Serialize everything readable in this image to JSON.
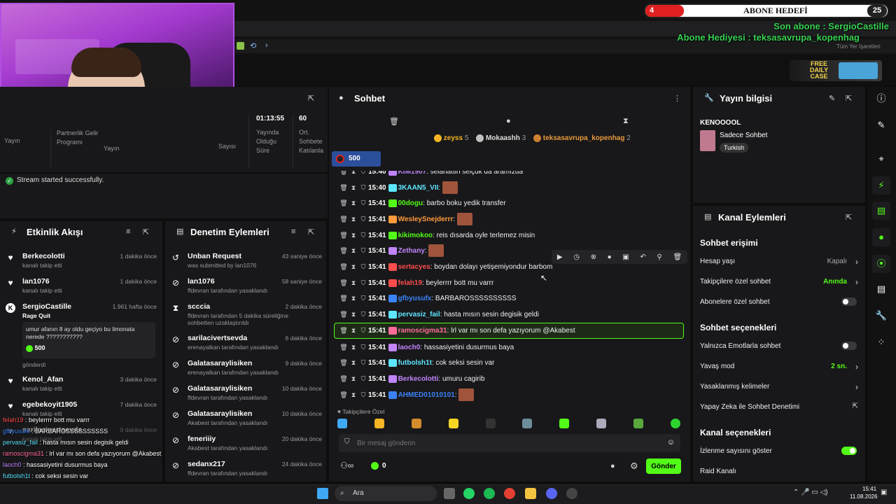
{
  "overlay": {
    "sub_goal": {
      "current": "4",
      "label": "ABONE HEDEFİ",
      "target": "25"
    },
    "alert_sub": "Son abone : SergioCastille",
    "alert_gift": "Abone Hediyesi : teksasavrupa_kopenhag",
    "all_bookmarks": "Tüm Yer İşaretleri",
    "promo": "FREE DAILY CASE"
  },
  "stats": {
    "items": [
      {
        "label": "Partnerlik Gelir Programı"
      },
      {
        "label": "Yayın"
      },
      {
        "value": "01:13:55",
        "label": "Yayında Olduğu Süre"
      },
      {
        "value": "60",
        "label": "Ort. Sohbete Katılanla"
      }
    ],
    "partial_label": "Sayısı",
    "left_label": "Yayın"
  },
  "success_msg": "Stream started successfully.",
  "events": {
    "title": "Etkinlik Akışı",
    "items": [
      {
        "name": "Berkecolotti",
        "sub": "kanalı takip etti",
        "time": "1 dakika önce"
      },
      {
        "name": "lan1076",
        "sub": "kanalı takip etti",
        "time": "1 dakika önce"
      },
      {
        "name": "SergioCastille",
        "sub": "Rage Quit",
        "time": "1.961 hafta önce",
        "message": "umur afanın 8 ay oldu geçiyo bu limonata nerede ???????????",
        "amount": "500",
        "note": "gönderdi"
      },
      {
        "name": "Kenol_Afan",
        "sub": "kanalı takip etti",
        "time": "3 dakika önce"
      },
      {
        "name": "egebekoyit1905",
        "sub": "kanalı takip etti",
        "time": "7 dakika önce"
      },
      {
        "name": "sarilacivertsevda",
        "sub": "kanalı takip etti",
        "time": "9 dakika önce"
      }
    ]
  },
  "moderation": {
    "title": "Denetim Eylemleri",
    "items": [
      {
        "name": "Unban Request",
        "sub": "was submitted by lan1076",
        "time": "43 saniye önce"
      },
      {
        "name": "lan1076",
        "sub": "ffdevran tarafından yasaklandı",
        "time": "58 saniye önce"
      },
      {
        "name": "scccia",
        "sub": "ffdevran tarafından 5 dakika süreliğine sohbetten uzaklaştırıldı",
        "time": "2 dakika önce"
      },
      {
        "name": "sarilacivertsevda",
        "sub": "erenayalkan tarafından yasaklandı",
        "time": "6 dakika önce"
      },
      {
        "name": "Galatasaraylisiken",
        "sub": "erenayalkan tarafından yasaklandı",
        "time": "9 dakika önce"
      },
      {
        "name": "Galatasaraylisiken",
        "sub": "ffdevran tarafından yasaklandı",
        "time": "10 dakika önce"
      },
      {
        "name": "Galatasaraylisiken",
        "sub": "Akabest tarafından yasaklandı",
        "time": "10 dakika önce"
      },
      {
        "name": "feneriiiy",
        "sub": "Akabest tarafından yasaklandı",
        "time": "20 dakika önce"
      },
      {
        "name": "sedanx217",
        "sub": "ffdevran tarafından yasaklandı",
        "time": "24 dakika önce"
      }
    ]
  },
  "chat": {
    "title": "Sohbet",
    "top_gifters": [
      {
        "name": "zeyss",
        "count": "5"
      },
      {
        "name": "Mokaashh",
        "count": "3"
      },
      {
        "name": "teksasavrupa_kopenhag",
        "count": "2"
      }
    ],
    "pinned_amount": "500",
    "messages": [
      {
        "time": "15:40",
        "user": "KIM1907",
        "color": "#c084fc",
        "text": "selahattin selçuk da aramızda"
      },
      {
        "time": "15:40",
        "user": "3KAAN5_VII",
        "color": "#5ee6ff",
        "text": ""
      },
      {
        "time": "15:41",
        "user": "00dogu",
        "color": "#53fc18",
        "text": "barbo boku yedik transfer"
      },
      {
        "time": "15:41",
        "user": "WesleySnejderrr",
        "color": "#ff9a3c",
        "text": ""
      },
      {
        "time": "15:41",
        "user": "kikimokoo",
        "color": "#53fc18",
        "text": "reis dısarda oyle terlemez misin"
      },
      {
        "time": "15:41",
        "user": "Zethany",
        "color": "#c084fc",
        "text": ""
      },
      {
        "time": "15:41",
        "user": "sertacyes",
        "color": "#ff4d4d",
        "text": "boydan dolayı yetişemiyondur barbom"
      },
      {
        "time": "15:41",
        "user": "felah19",
        "color": "#ff4d4d",
        "text": "beylerrrr bott mu varrr"
      },
      {
        "time": "15:41",
        "user": "gfbyusufx",
        "color": "#3b82f6",
        "text": "BARBAROSSSSSSSSSS"
      },
      {
        "time": "15:41",
        "user": "pervasiz_fail",
        "color": "#5ee6ff",
        "text": "hasta mısın sesin degisik geldi"
      },
      {
        "time": "15:41",
        "user": "ramoscigma31",
        "color": "#ff6b9a",
        "text": "lrl var mı son defa yazıyorum @Akabest"
      },
      {
        "time": "15:41",
        "user": "laoch0",
        "color": "#c084fc",
        "text": "hassasiyetini dusurmus baya"
      },
      {
        "time": "15:41",
        "user": "futbolsh1t",
        "color": "#5ee6ff",
        "text": "cok seksi sesin var"
      },
      {
        "time": "15:41",
        "user": "Berkecolotti",
        "color": "#c084fc",
        "text": "umuru cagirib"
      },
      {
        "time": "15:41",
        "user": "AHMED01010101",
        "color": "#3b82f6",
        "text": ""
      }
    ],
    "followers_only": "Takipçilere Özel",
    "input_placeholder": "Bir mesaj gönderin",
    "points": "0",
    "send_label": "Gönder"
  },
  "stream_info": {
    "title": "Yayın bilgisi",
    "channel": "KENOOOOL",
    "category": "Sadece Sohbet",
    "tag": "Turkish"
  },
  "channel_actions": {
    "title": "Kanal Eylemleri",
    "sections": [
      {
        "heading": "Sohbet erişimi",
        "rows": [
          {
            "label": "Hesap yaşı",
            "value": "Kapalı",
            "kind": "chevron"
          },
          {
            "label": "Takipçilere özel sohbet",
            "value": "Anında",
            "kind": "chevron",
            "green": true
          },
          {
            "label": "Abonelere özel sohbet",
            "kind": "toggle-off"
          }
        ]
      },
      {
        "heading": "Sohbet seçenekleri",
        "rows": [
          {
            "label": "Yalnızca Emotlarla sohbet",
            "kind": "toggle-off"
          },
          {
            "label": "Yavaş mod",
            "value": "2 sn.",
            "kind": "chevron",
            "green": true
          },
          {
            "label": "Yasaklanmış kelimeler",
            "kind": "chevron"
          },
          {
            "label": "Yapay Zeka ile Sohbet Denetimi",
            "kind": "external"
          }
        ]
      },
      {
        "heading": "Kanal seçenekleri",
        "rows": [
          {
            "label": "İzlenme sayısını göster",
            "kind": "toggle-on"
          },
          {
            "label": "Raid Kanalı",
            "kind": "none"
          }
        ]
      }
    ]
  },
  "overlay_chat": [
    {
      "user": "felah19",
      "color": "#ff4d4d",
      "text": "beylerrrr bott mu varrr"
    },
    {
      "user": "gfbyusufx",
      "color": "#3b82f6",
      "text": "BARBAROSSSSSSSSSS"
    },
    {
      "user": "pervasiz_fail",
      "color": "#5ee6ff",
      "text": "hasta mısın sesin degisik geldi"
    },
    {
      "user": "ramoscigma31",
      "color": "#ff6b9a",
      "text": "lrl var mı son defa yazıyorum @Akabest"
    },
    {
      "user": "laoch0",
      "color": "#c084fc",
      "text": "hassasiyetini dusurmus baya"
    },
    {
      "user": "futbolsh1t",
      "color": "#5ee6ff",
      "text": "cok seksi sesin var"
    },
    {
      "user": "Berkecolotti",
      "color": "#c084fc",
      "text": "umuru cagirib"
    },
    {
      "user": "AHMED01010101",
      "color": "#3b82f6",
      "text": ""
    }
  ],
  "taskbar": {
    "search": "Ara",
    "time": "15:41",
    "date": "11.08.2026"
  }
}
